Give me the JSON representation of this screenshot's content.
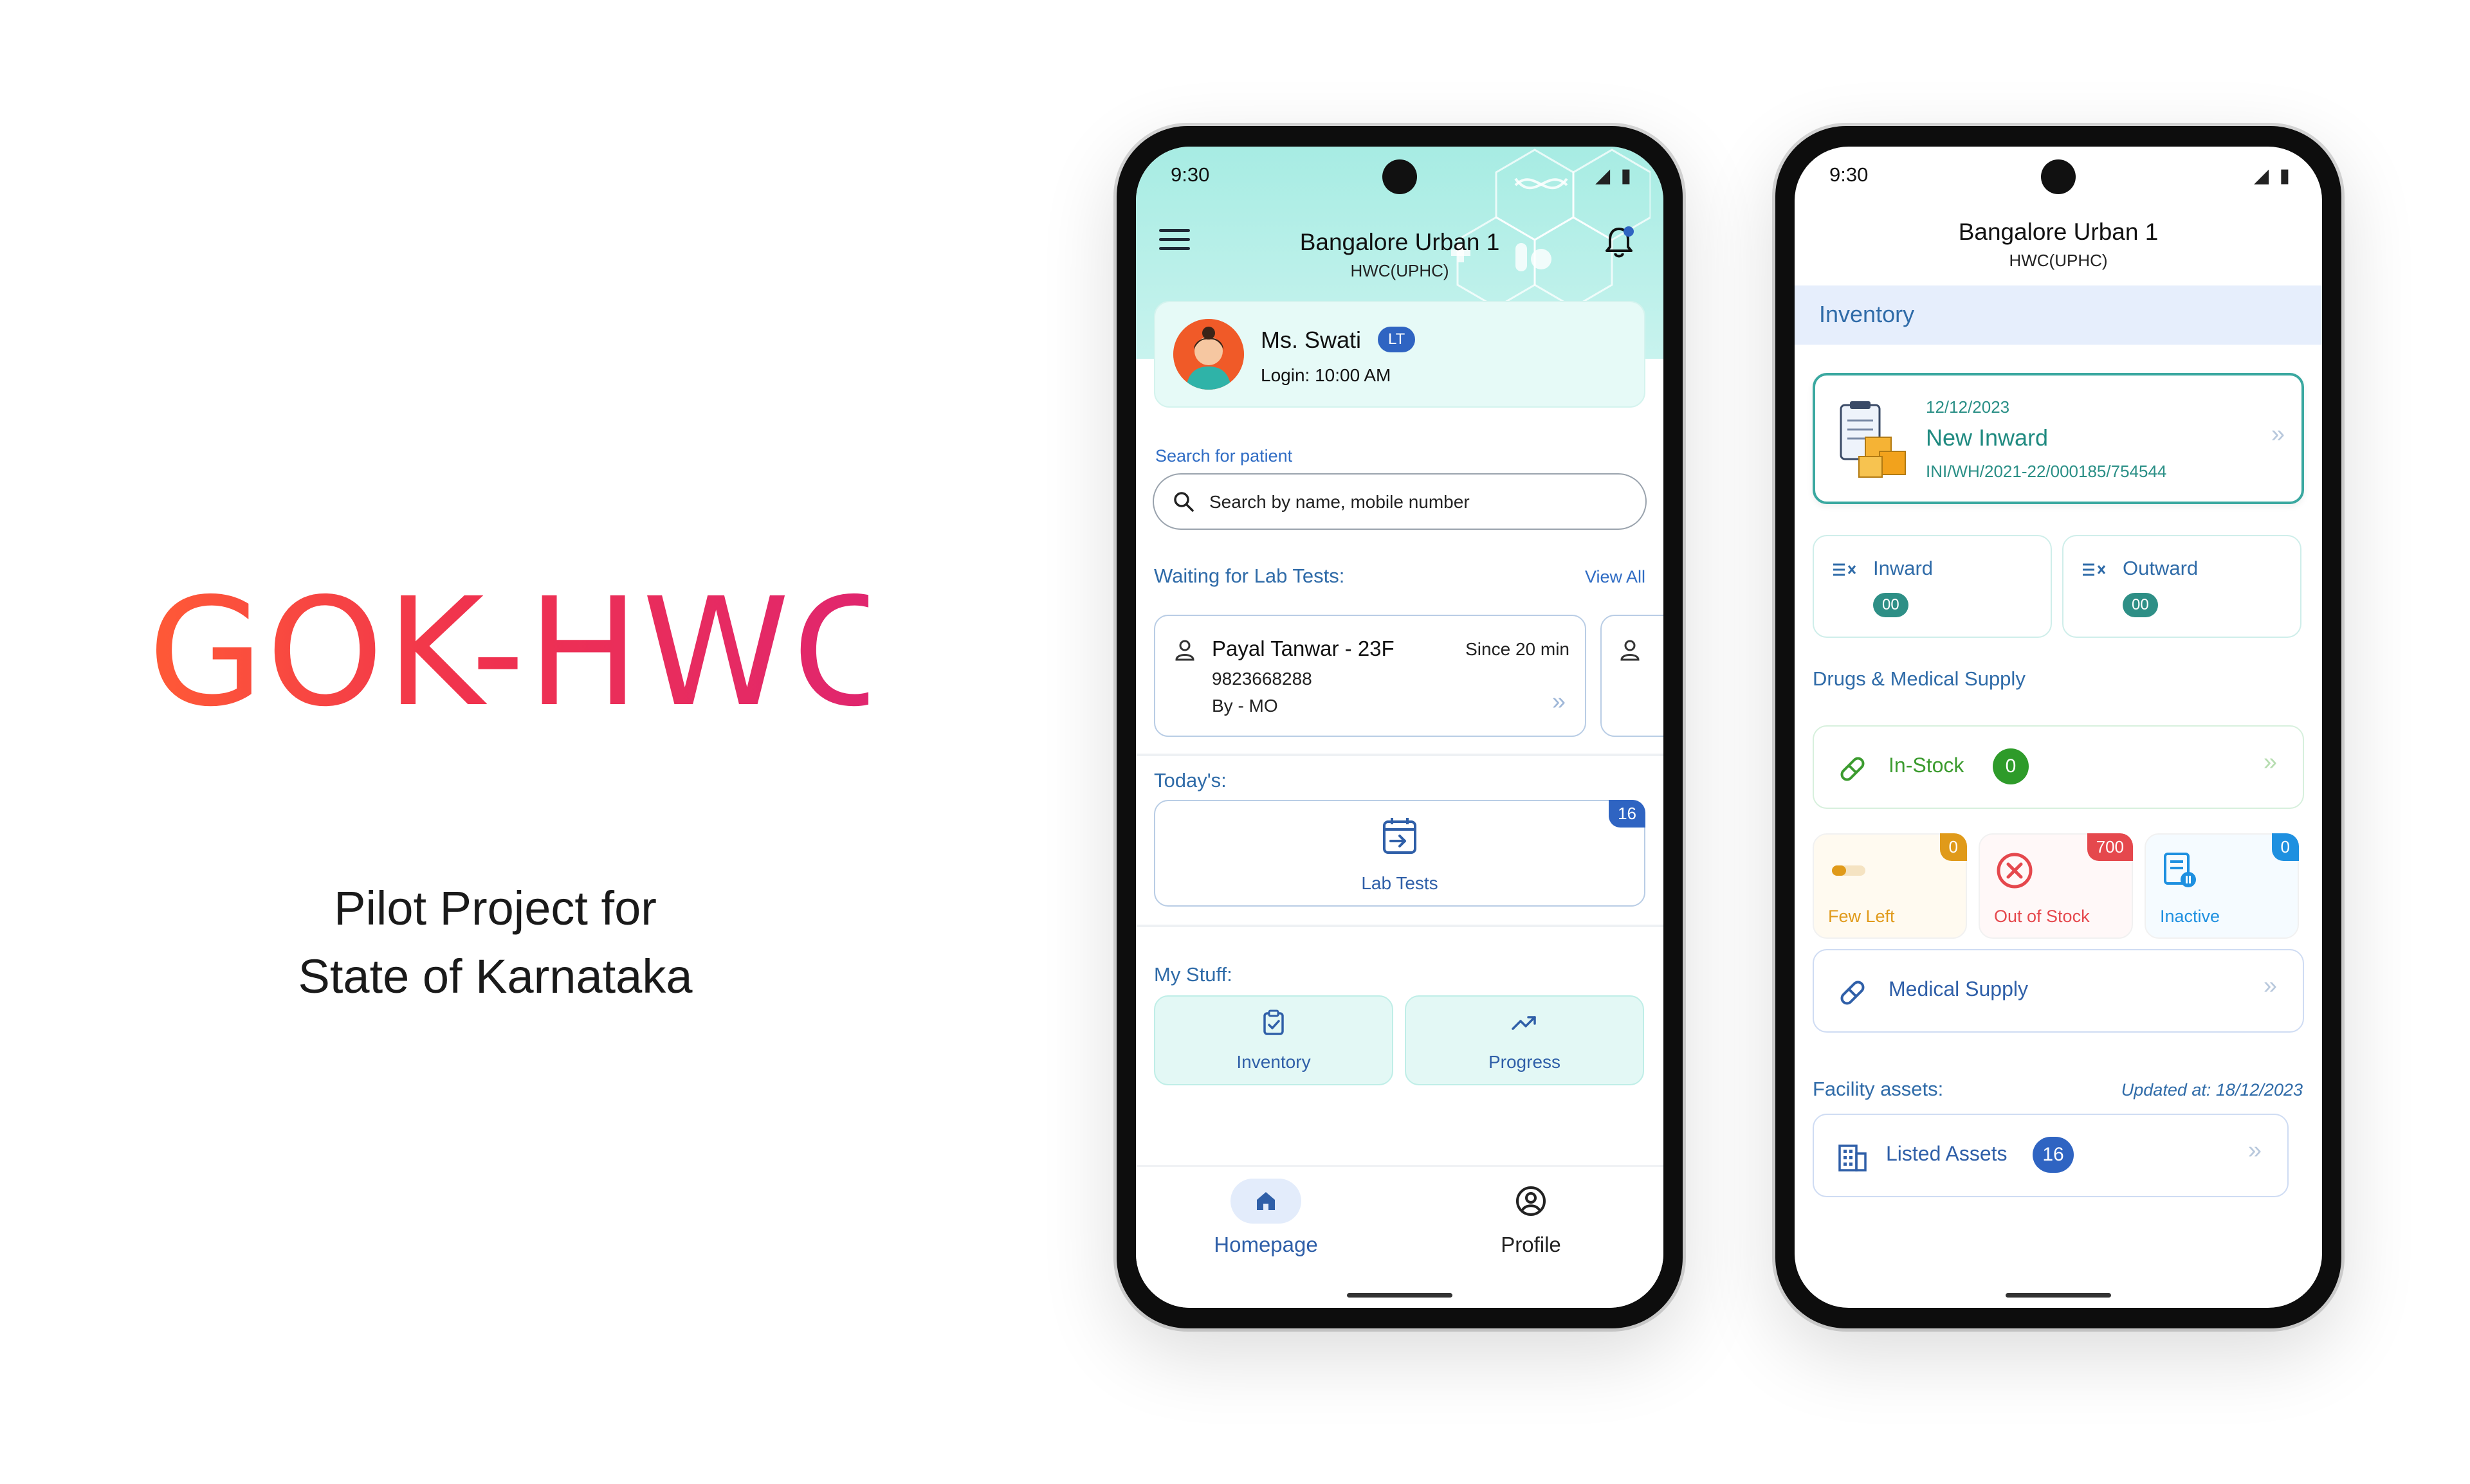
{
  "brand": {
    "title": "GOK-HWC",
    "subtitle_line1": "Pilot Project for",
    "subtitle_line2": "State of Karnataka"
  },
  "phone1": {
    "status_time": "9:30",
    "header": {
      "title": "Bangalore Urban 1",
      "subtitle": "HWC(UPHC)"
    },
    "profile": {
      "name": "Ms. Swati",
      "role_badge": "LT",
      "login": "Login: 10:00 AM"
    },
    "search": {
      "label": "Search for patient",
      "placeholder": "Search by name, mobile number"
    },
    "waiting": {
      "title": "Waiting for Lab Tests:",
      "view_all": "View All",
      "patient": {
        "name": "Payal Tanwar - 23F",
        "since": "Since 20 min",
        "phone": "9823668288",
        "by": "By - MO"
      }
    },
    "today": {
      "title": "Today's:",
      "lab_tests_label": "Lab Tests",
      "lab_tests_count": "16"
    },
    "my_stuff": {
      "title": "My Stuff:",
      "inventory": "Inventory",
      "progress": "Progress"
    },
    "nav": {
      "home": "Homepage",
      "profile": "Profile"
    }
  },
  "phone2": {
    "status_time": "9:30",
    "header": {
      "title": "Bangalore Urban 1",
      "subtitle": "HWC(UPHC)"
    },
    "section": "Inventory",
    "new_inward": {
      "date": "12/12/2023",
      "title": "New Inward",
      "ref": "INI/WH/2021-22/000185/754544"
    },
    "inward": {
      "label": "Inward",
      "count": "00"
    },
    "outward": {
      "label": "Outward",
      "count": "00"
    },
    "drugs": {
      "title": "Drugs & Medical Supply",
      "in_stock": {
        "label": "In-Stock",
        "count": "0"
      },
      "few_left": {
        "label": "Few Left",
        "count": "0"
      },
      "out_of_stock": {
        "label": "Out of Stock",
        "count": "700"
      },
      "inactive": {
        "label": "Inactive",
        "count": "0"
      },
      "medical_supply": "Medical Supply"
    },
    "assets": {
      "title": "Facility assets:",
      "updated": "Updated at: 18/12/2023",
      "listed_label": "Listed Assets",
      "listed_count": "16"
    }
  },
  "colors": {
    "brand_gradient_start": "#ff5a36",
    "brand_gradient_end": "#e0266e",
    "primary_blue": "#2f64c2",
    "teal": "#2e8f86",
    "header_mint": "#a7ece3",
    "in_stock_green": "#2e9b2a",
    "few_left_orange": "#e09a1a",
    "out_of_stock_red": "#e5484d",
    "inactive_blue": "#1e90e0"
  },
  "icons": [
    "menu-icon",
    "bell-icon",
    "search-icon",
    "person-icon",
    "chevron-double-right-icon",
    "lab-tests-icon",
    "inventory-clipboard-icon",
    "progress-trend-icon",
    "home-icon",
    "profile-icon",
    "inward-icon",
    "outward-icon",
    "pill-icon",
    "few-left-icon",
    "out-of-stock-icon",
    "inactive-icon",
    "assets-building-icon"
  ]
}
